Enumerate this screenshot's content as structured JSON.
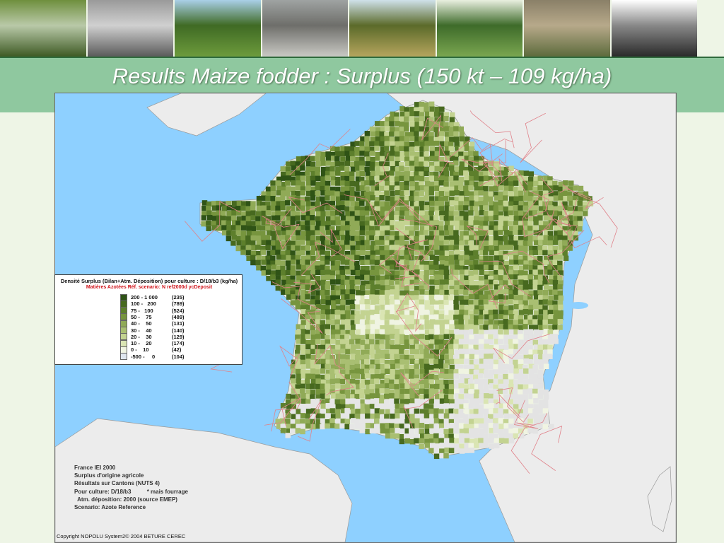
{
  "header": {
    "title": "Results Maize fodder : Surplus (150 kt – 109 kg/ha)",
    "photos": [
      {
        "name": "tractor-field-photo",
        "colors": [
          "#6f8f3e",
          "#3e5a24",
          "#b9c9a8"
        ]
      },
      {
        "name": "orchard-bw-photo",
        "colors": [
          "#9a9a9a",
          "#5a5a5a",
          "#d0d0d0"
        ]
      },
      {
        "name": "orchard-cows-photo",
        "colors": [
          "#a9cfe8",
          "#6d9b3c",
          "#3f6a24"
        ]
      },
      {
        "name": "dairy-equipment-photo",
        "colors": [
          "#9fa3a2",
          "#c9c9c4",
          "#6e6e6a"
        ]
      },
      {
        "name": "cattle-pasture-photo",
        "colors": [
          "#cfe1ea",
          "#b5a55d",
          "#5b6a2a"
        ]
      },
      {
        "name": "blossoming-orchard-photo",
        "colors": [
          "#e9efe0",
          "#7aa650",
          "#3e6b2a"
        ]
      },
      {
        "name": "scrubland-photo",
        "colors": [
          "#8a8068",
          "#5d6b3c",
          "#b7a98a"
        ]
      },
      {
        "name": "tree-sketch-photo",
        "colors": [
          "#ffffff",
          "#2a2a2a",
          "#888888"
        ]
      }
    ]
  },
  "legend": {
    "title": "Densité Surplus (Bilan+Atm. Déposition) pour culture : D/18/b3  (kg/ha)",
    "subtitle": "Matières Azotées  Réf. scenario: N ref2000d ycDeposit",
    "classes": [
      {
        "range": "200 - 1 000",
        "count": "(235)",
        "color": "#2f5316"
      },
      {
        "range": "100 -   200",
        "count": "(789)",
        "color": "#47691f"
      },
      {
        "range": "75 -   100",
        "count": "(524)",
        "color": "#5d7f2c"
      },
      {
        "range": "50 -    75",
        "count": "(489)",
        "color": "#77953e"
      },
      {
        "range": "40 -    50",
        "count": "(131)",
        "color": "#90aa57"
      },
      {
        "range": "30 -    40",
        "count": "(140)",
        "color": "#a9bf72"
      },
      {
        "range": "20 -    30",
        "count": "(129)",
        "color": "#c3d391"
      },
      {
        "range": "10 -    20",
        "count": "(174)",
        "color": "#dae5b3"
      },
      {
        "range": "0 -    10",
        "count": "(42)",
        "color": "#f0f4e2"
      },
      {
        "range": "-500 -     0",
        "count": "(104)",
        "color": "#dfe6ee"
      }
    ]
  },
  "info_lines": [
    "France IEI 2000",
    "Surplus d'origine agricole",
    "Résultats sur Cantons (NUTS 4)",
    "Pour culture: D/18/b3          * mais fourrage",
    "  Atm. déposition: 2000 (source EMEP)",
    "Scenario: Azote Reference"
  ],
  "copyright": "Copyright NOPOLU System2© 2004 BETURE CEREC",
  "map": {
    "sea_color": "#8ed0ff",
    "land_color": "#ececec",
    "border_color": "#e0828a",
    "class_colors": [
      "#2f5316",
      "#47691f",
      "#5d7f2c",
      "#77953e",
      "#90aa57",
      "#a9bf72",
      "#c3d391",
      "#dae5b3",
      "#f0f4e2",
      "#dfe6ee"
    ]
  }
}
